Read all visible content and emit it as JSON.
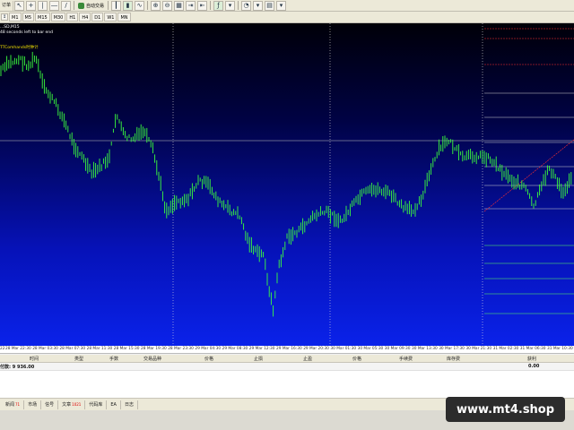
{
  "toolbar_top": {
    "left_label": "订单",
    "autotrade_label": "自动交易"
  },
  "timeframes": [
    "M1",
    "M5",
    "M15",
    "M30",
    "H1",
    "H4",
    "D1",
    "W1",
    "MN"
  ],
  "chart": {
    "symbol_line": "...SD,M15",
    "timer_text": "48 seconds left to bar end",
    "indicator_label": "TTComhands时钟计",
    "colors": {
      "bg_top": "#000008",
      "bg_bottom": "#0a22ea",
      "candle": "#3cff3c",
      "line_white": "#c8c8c8",
      "line_red": "#ff3030",
      "grid_dot": "#e0e0e0"
    },
    "x_labels": [
      "22",
      "28 Mar 22:30",
      "28 Mar 03:30",
      "28 Mar 07:30",
      "28 Mar 11:30",
      "28 Mar 15:30",
      "28 Mar 19:30",
      "28 Mar 23:30",
      "29 Mar 04:30",
      "29 Mar 08:30",
      "29 Mar 12:30",
      "29 Mar 16:30",
      "29 Mar 20:30",
      "30 Mar 01:30",
      "30 Mar 05:30",
      "30 Mar 09:30",
      "30 Mar 13:30",
      "30 Mar 17:30",
      "30 Mar 21:30",
      "31 Mar 02:30",
      "31 Mar 06:30",
      "31 Mar 10:30"
    ]
  },
  "terminal": {
    "columns": [
      "时间",
      "类型",
      "手数",
      "交易品种",
      "价格",
      "止损",
      "止盈",
      "价格",
      "手续费",
      "库存费",
      "获利"
    ],
    "balance_text": "付款: 9 936.00",
    "profit_total": "0.00"
  },
  "tabs": [
    {
      "label": "新闻",
      "badge": "71"
    },
    {
      "label": "市场",
      "badge": ""
    },
    {
      "label": "信号",
      "badge": ""
    },
    {
      "label": "文章",
      "badge": "1021"
    },
    {
      "label": "代码库",
      "badge": ""
    },
    {
      "label": "EA",
      "badge": ""
    },
    {
      "label": "日志",
      "badge": ""
    }
  ],
  "watermark": "www.mt4.shop"
}
